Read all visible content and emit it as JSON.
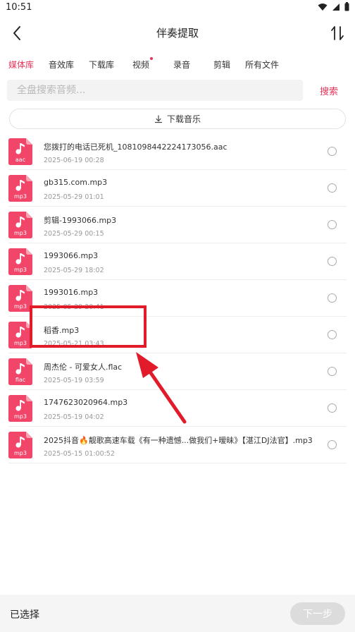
{
  "status_bar": {
    "time": "10:51"
  },
  "header": {
    "title": "伴奏提取",
    "back_icon": "chevron-left-icon",
    "sort_icon": "sort-arrows-icon"
  },
  "tabs": [
    {
      "label": "媒体库",
      "active": true
    },
    {
      "label": "音效库",
      "active": false
    },
    {
      "label": "下载库",
      "active": false
    },
    {
      "label": "视频",
      "active": false,
      "badge_dot": true
    },
    {
      "label": "录音",
      "active": false
    },
    {
      "label": "剪辑",
      "active": false
    },
    {
      "label": "所有文件",
      "active": false
    }
  ],
  "search": {
    "placeholder": "全盘搜索音频...",
    "value": "",
    "button_label": "搜索"
  },
  "download_button": {
    "label": "下载音乐",
    "icon": "download-icon"
  },
  "files": [
    {
      "type": "aac",
      "name": "您拨打的电话已死机_1081098442224173056.aac",
      "date": "2025-06-19  00:28"
    },
    {
      "type": "mp3",
      "name": "gb315.com.mp3",
      "date": "2025-05-29  01:01"
    },
    {
      "type": "mp3",
      "name": "剪辑-1993066.mp3",
      "date": "2025-05-29  00:15"
    },
    {
      "type": "mp3",
      "name": "1993066.mp3",
      "date": "2025-05-29  18:02"
    },
    {
      "type": "mp3",
      "name": "1993016.mp3",
      "date": "2025-05-29  20:41"
    },
    {
      "type": "mp3",
      "name": "稻香.mp3",
      "date": "2025-05-21  03:43"
    },
    {
      "type": "flac",
      "name": "周杰伦 - 可爱女人.flac",
      "date": "2025-05-19  03:59"
    },
    {
      "type": "mp3",
      "name": "1747623020964.mp3",
      "date": "2025-05-19  04:02"
    },
    {
      "type": "mp3",
      "name": "2025抖音🔥靓歌高速车载《有一种遗憾...做我们+暧昧》【湛江DJ法官】.mp3",
      "date": "2025-05-15  01:00:52"
    }
  ],
  "bottom_bar": {
    "selected_label": "已选择",
    "next_label": "下一步"
  },
  "colors": {
    "accent": "#e8345a",
    "annotation": "#e21b2a"
  }
}
